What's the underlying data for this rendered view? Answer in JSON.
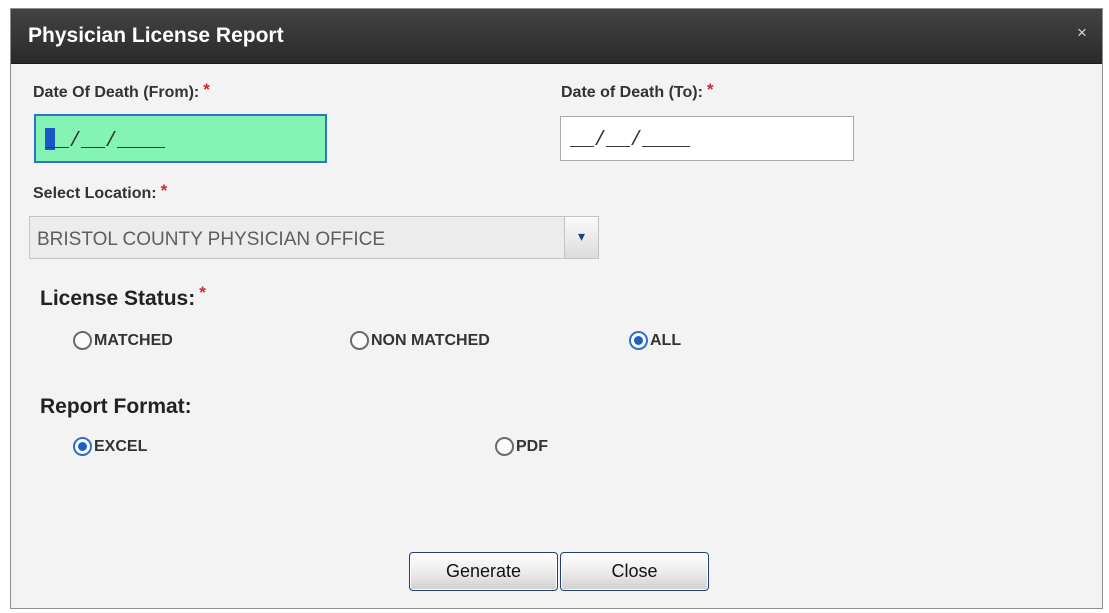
{
  "dialog": {
    "title": "Physician License Report",
    "close_icon": "close-icon",
    "close_glyph": "×"
  },
  "form": {
    "date_from": {
      "label": "Date Of Death (From):",
      "required_mark": "*",
      "value": "__/__/____"
    },
    "date_to": {
      "label": "Date of Death (To):",
      "required_mark": "*",
      "value": "__/__/____"
    },
    "location": {
      "label": "Select Location:",
      "required_mark": "*",
      "selected": "BRISTOL COUNTY PHYSICIAN OFFICE",
      "dropdown_icon": "chevron-down-icon",
      "dropdown_glyph": "▾"
    },
    "license_status": {
      "label": "License Status:",
      "required_mark": "*",
      "options": [
        {
          "label": "MATCHED",
          "checked": false
        },
        {
          "label": "NON MATCHED",
          "checked": false
        },
        {
          "label": "ALL",
          "checked": true
        }
      ]
    },
    "report_format": {
      "label": "Report Format:",
      "options": [
        {
          "label": "EXCEL",
          "checked": true
        },
        {
          "label": "PDF",
          "checked": false
        }
      ]
    }
  },
  "buttons": {
    "generate": "Generate",
    "close": "Close"
  },
  "colors": {
    "titlebar": "#333333",
    "dialog_bg": "#f3f3f4",
    "focused_input_bg": "#85f3b3",
    "focus_border": "#2d73ce",
    "required_star": "#d22828",
    "radio_checked": "#1e5fc7"
  }
}
